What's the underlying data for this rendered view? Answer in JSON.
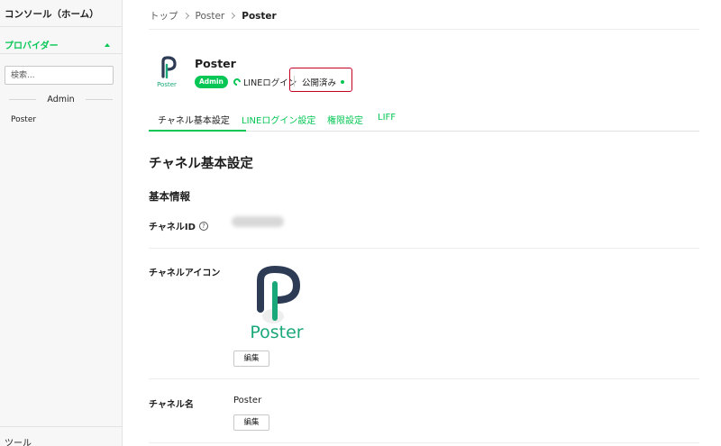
{
  "sidebar": {
    "console": "コンソール（ホーム）",
    "provider": "プロバイダー",
    "search_placeholder": "検索...",
    "group": "Admin",
    "channel": "Poster",
    "tools": "ツール"
  },
  "breadcrumb": {
    "top": "トップ",
    "provider": "Poster",
    "current": "Poster"
  },
  "channel": {
    "name": "Poster",
    "logo_text": "Poster",
    "role_badge": "Admin",
    "login_type": "LINEログイン",
    "status": "公開済み",
    "status_color": "#06c755"
  },
  "tabs": [
    {
      "label": "チャネル基本設定",
      "active": true
    },
    {
      "label": "LINEログイン設定",
      "active": false
    },
    {
      "label": "権限設定",
      "active": false
    },
    {
      "label": "LIFF",
      "active": false
    }
  ],
  "content": {
    "section_title": "チャネル基本設定",
    "sub_title": "基本情報",
    "channel_id_label": "チャネルID",
    "help_icon": "?",
    "channel_icon_label": "チャネルアイコン",
    "icon_text": "Poster",
    "edit_label": "編集",
    "channel_name_label": "チャネル名",
    "channel_name_value": "Poster"
  },
  "colors": {
    "accent": "#06c755",
    "highlight": "#c40020",
    "logo_dark": "#2d3b55"
  }
}
